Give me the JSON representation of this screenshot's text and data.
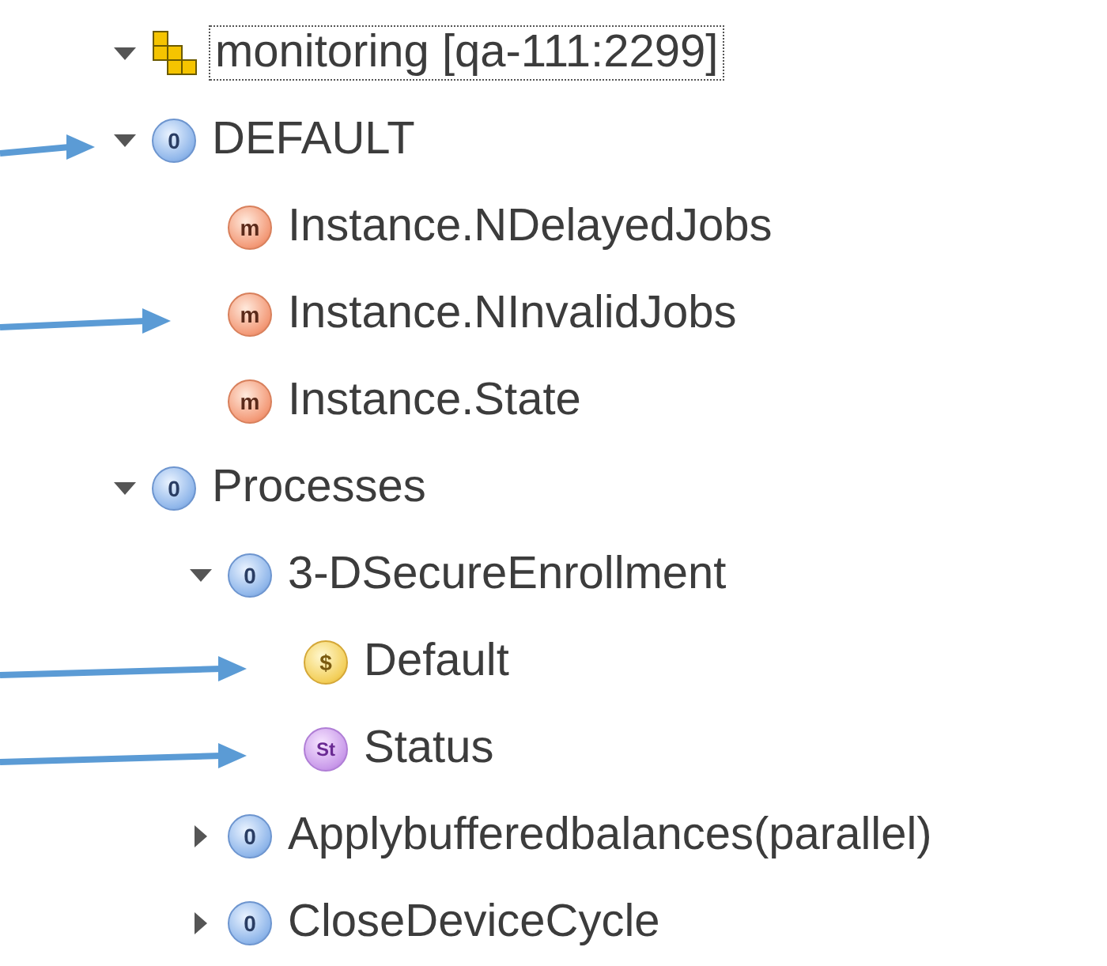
{
  "tree": {
    "root": {
      "label": "monitoring [qa-111:2299]",
      "kind": "domain",
      "expanded": true,
      "focused": true,
      "children": [
        {
          "label": "DEFAULT",
          "kind": "object",
          "badge": "0",
          "expanded": true,
          "pointed": true,
          "children": [
            {
              "label": "Instance.NDelayedJobs",
              "kind": "metric",
              "badge": "m",
              "pointed": false
            },
            {
              "label": "Instance.NInvalidJobs",
              "kind": "metric",
              "badge": "m",
              "pointed": true
            },
            {
              "label": "Instance.State",
              "kind": "metric",
              "badge": "m",
              "pointed": false
            }
          ]
        },
        {
          "label": "Processes",
          "kind": "object",
          "badge": "0",
          "expanded": true,
          "pointed": false,
          "children": [
            {
              "label": "3-DSecureEnrollment",
              "kind": "object",
              "badge": "0",
              "expanded": true,
              "pointed": false,
              "children": [
                {
                  "label": "Default",
                  "kind": "setting",
                  "badge": "$",
                  "pointed": true
                },
                {
                  "label": "Status",
                  "kind": "state",
                  "badge": "St",
                  "pointed": true
                }
              ]
            },
            {
              "label": "Applybufferedbalances(parallel)",
              "kind": "object",
              "badge": "0",
              "expanded": false,
              "pointed": false
            },
            {
              "label": "CloseDeviceCycle",
              "kind": "object",
              "badge": "0",
              "expanded": false,
              "pointed": false
            }
          ]
        }
      ]
    }
  }
}
